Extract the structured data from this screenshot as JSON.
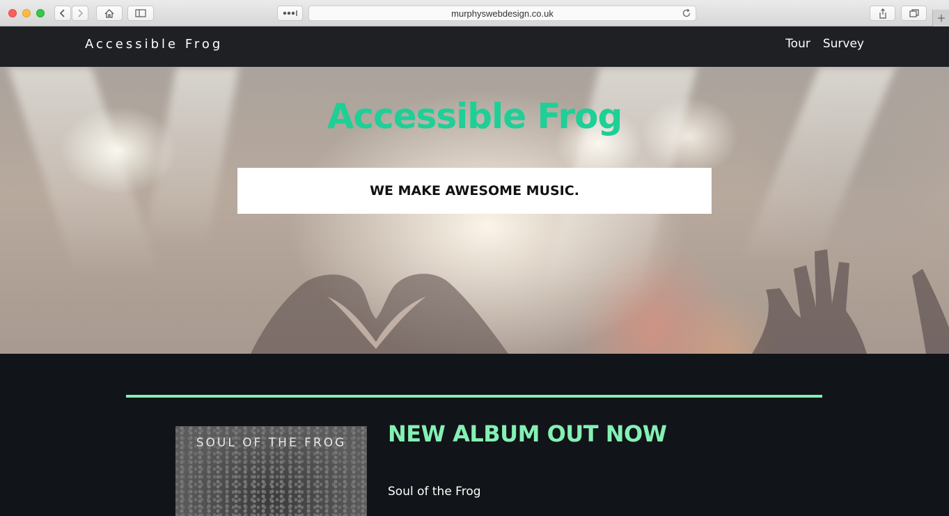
{
  "browser": {
    "url": "murphyswebdesign.co.uk",
    "icons": {
      "back": "chevron-left-icon",
      "forward": "chevron-right-icon",
      "home": "home-icon",
      "sidebar": "sidebar-icon",
      "reader": "more-icon",
      "reload": "reload-icon",
      "share": "share-icon",
      "tabs": "tabs-icon",
      "new_tab": "plus-icon"
    }
  },
  "nav": {
    "brand": "Accessible Frog",
    "links": [
      {
        "label": "Tour"
      },
      {
        "label": "Survey"
      }
    ]
  },
  "hero": {
    "title": "Accessible Frog",
    "tagline": "WE MAKE AWESOME MUSIC."
  },
  "album": {
    "cover_text": "SOUL OF THE FROG",
    "heading": "NEW ALBUM OUT NOW",
    "name": "Soul of the Frog"
  },
  "colors": {
    "accent_green": "#1ecf96",
    "mint": "#84f0b4",
    "nav_bg": "#1e2024",
    "page_bg": "#111418"
  }
}
